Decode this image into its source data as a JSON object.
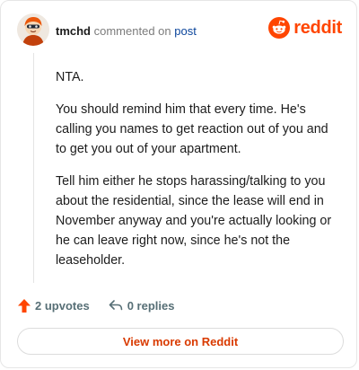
{
  "header": {
    "username": "tmchd",
    "action_text": "commented on",
    "post_link": "post",
    "brand_name": "reddit",
    "brand_color": "#ff4500"
  },
  "comment": {
    "paragraphs": [
      "NTA.",
      "You should remind him that every time. He's calling you names to get reaction out of you and to get you out of your apartment.",
      "Tell him either he stops harassing/talking to you about the residential, since the lease will end in November anyway and you're actually looking or he can leave right now, since he's not the leaseholder."
    ]
  },
  "actions": {
    "upvotes": "2 upvotes",
    "replies": "0 replies",
    "upvote_icon": "upvote-arrow-icon",
    "reply_icon": "reply-arrow-icon"
  },
  "footer": {
    "view_more": "View more on Reddit"
  }
}
